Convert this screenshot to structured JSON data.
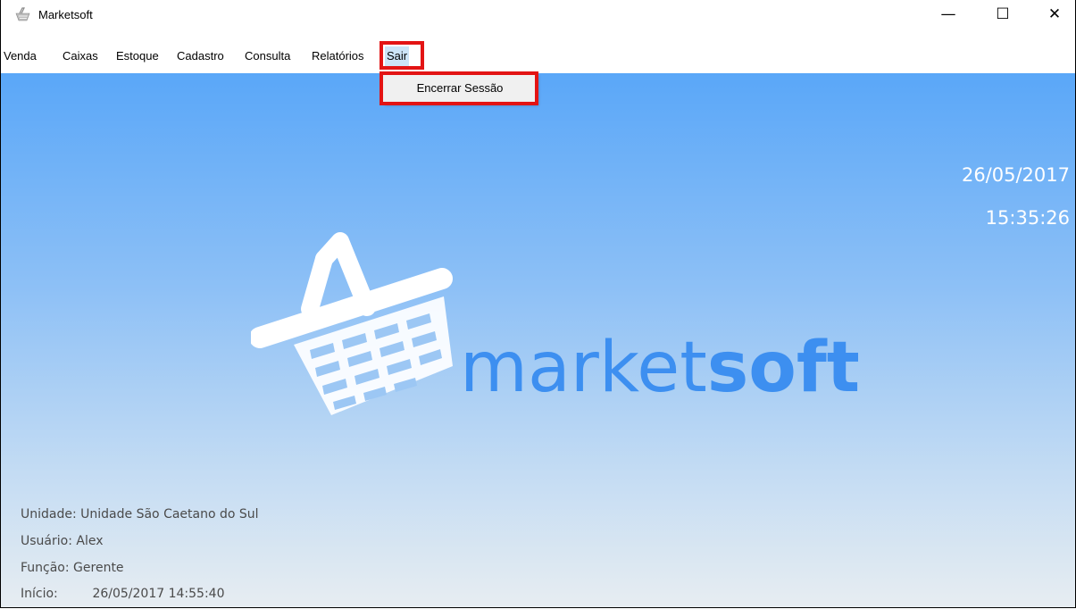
{
  "window": {
    "title": "Marketsoft",
    "minimize_glyph": "—",
    "maximize_glyph": "☐",
    "close_glyph": "✕"
  },
  "menu": {
    "items": [
      "Venda",
      "Caixas",
      "Estoque",
      "Cadastro",
      "Consulta",
      "Relatórios",
      "Sair"
    ],
    "active": "Sair",
    "dropdown": [
      "Encerrar Sessão"
    ]
  },
  "clock": {
    "date": "26/05/2017",
    "time": "15:35:26"
  },
  "logo": {
    "text_light": "market",
    "text_bold": "soft",
    "icon": "shopping-basket-icon"
  },
  "info": {
    "unidade_label": "Unidade:",
    "unidade_value": "Unidade São Caetano do Sul",
    "usuario_label": "Usuário:",
    "usuario_value": "Alex",
    "funcao_label": "Função:",
    "funcao_value": "Gerente",
    "inicio_label": "Início:",
    "inicio_value": "26/05/2017 14:55:40"
  },
  "colors": {
    "highlight": "#e31414",
    "logo_blue": "#3d8ff0",
    "background_top": "#5aa7f8",
    "background_bottom": "#e7edf2"
  }
}
